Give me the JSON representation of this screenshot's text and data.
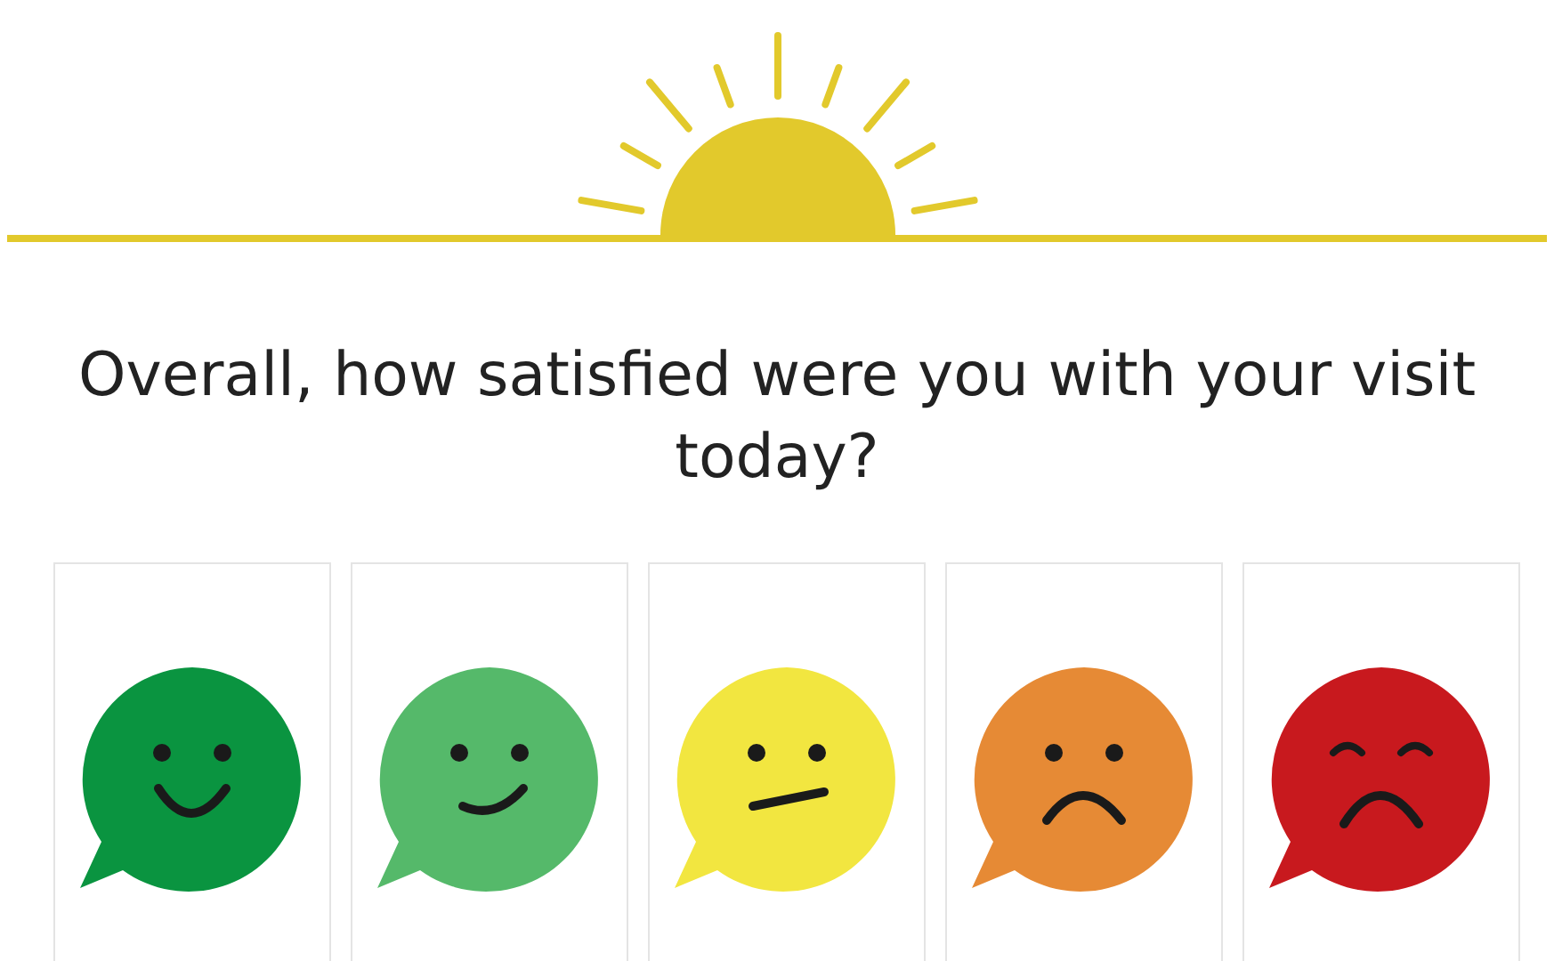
{
  "question": "Overall, how satisfied were you with your visit today?",
  "options": [
    {
      "kind": "very-happy",
      "color": "#0a9440"
    },
    {
      "kind": "happy",
      "color": "#55b96a"
    },
    {
      "kind": "neutral",
      "color": "#f2e640"
    },
    {
      "kind": "sad",
      "color": "#e68a35"
    },
    {
      "kind": "very-sad",
      "color": "#c8191e"
    }
  ]
}
